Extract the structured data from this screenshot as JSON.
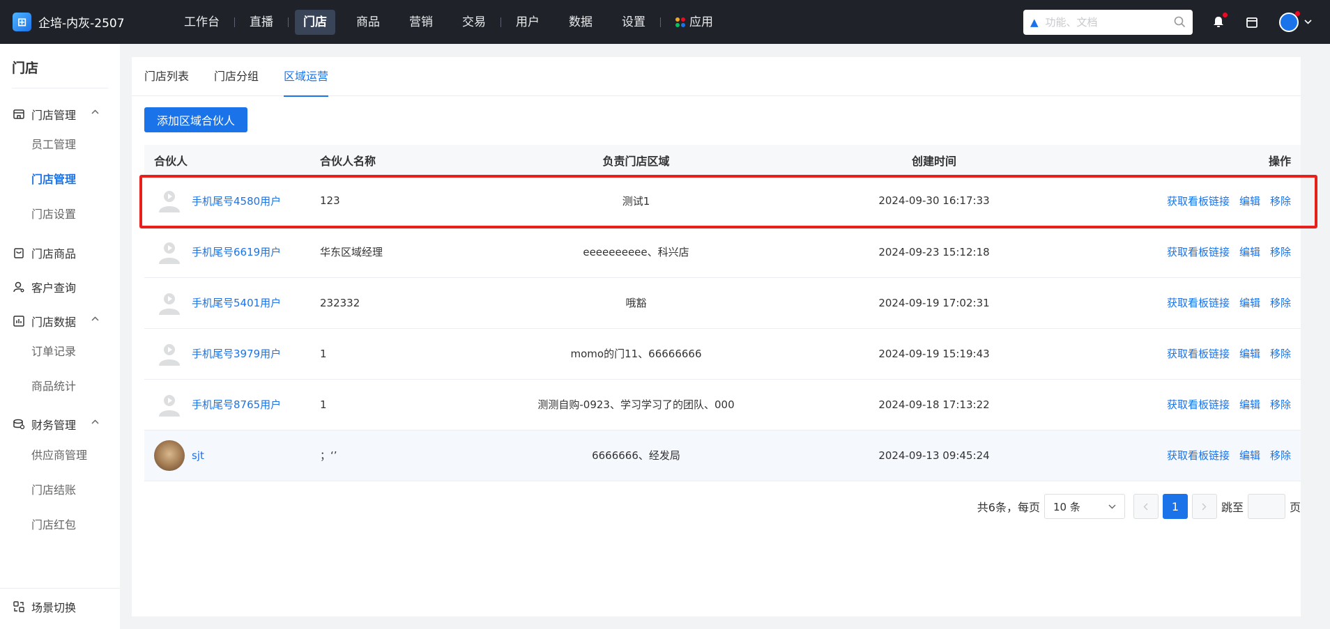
{
  "brand": {
    "name": "企培-内灰-2507"
  },
  "nav": {
    "items": [
      "工作台",
      "直播",
      "门店",
      "商品",
      "营销",
      "交易",
      "用户",
      "数据",
      "设置",
      "应用"
    ]
  },
  "search": {
    "placeholder": "功能、文档"
  },
  "sidebar": {
    "title": "门店",
    "groups": [
      {
        "label": "门店管理",
        "subs": [
          "员工管理",
          "门店管理",
          "门店设置"
        ]
      },
      {
        "label": "门店商品"
      },
      {
        "label": "客户查询"
      },
      {
        "label": "门店数据",
        "subs": [
          "订单记录",
          "商品统计"
        ]
      },
      {
        "label": "财务管理",
        "subs": [
          "供应商管理",
          "门店结账",
          "门店红包"
        ]
      }
    ],
    "bottom": "场景切换"
  },
  "tabs": [
    "门店列表",
    "门店分组",
    "区域运营"
  ],
  "add_button": "添加区域合伙人",
  "table": {
    "headers": [
      "合伙人",
      "合伙人名称",
      "负责门店区域",
      "创建时间",
      "操作"
    ],
    "actions": [
      "获取看板链接",
      "编辑",
      "移除"
    ],
    "rows": [
      {
        "partner": "手机尾号4580用户",
        "name": "123",
        "area": "测试1",
        "time": "2024-09-30 16:17:33"
      },
      {
        "partner": "手机尾号6619用户",
        "name": "华东区域经理",
        "area": "eeeeeeeeee、科兴店",
        "time": "2024-09-23 15:12:18"
      },
      {
        "partner": "手机尾号5401用户",
        "name": "232332",
        "area": "哦豁",
        "time": "2024-09-19 17:02:31"
      },
      {
        "partner": "手机尾号3979用户",
        "name": "1",
        "area": "momo的门11、66666666",
        "time": "2024-09-19 15:19:43"
      },
      {
        "partner": "手机尾号8765用户",
        "name": "1",
        "area": "测测自购-0923、学习学习了的团队、000",
        "time": "2024-09-18 17:13:22"
      },
      {
        "partner": "sjt",
        "name": "；‘’",
        "area": "6666666、经发局",
        "time": "2024-09-13 09:45:24"
      }
    ]
  },
  "pagination": {
    "total": "共6条，每页",
    "page_size": "10 条",
    "current": "1",
    "jump_label": "跳至",
    "page_label": "页"
  },
  "colors": {
    "primary": "#1a73e8",
    "topbar": "#1f2329",
    "highlight": "#e8201b"
  }
}
